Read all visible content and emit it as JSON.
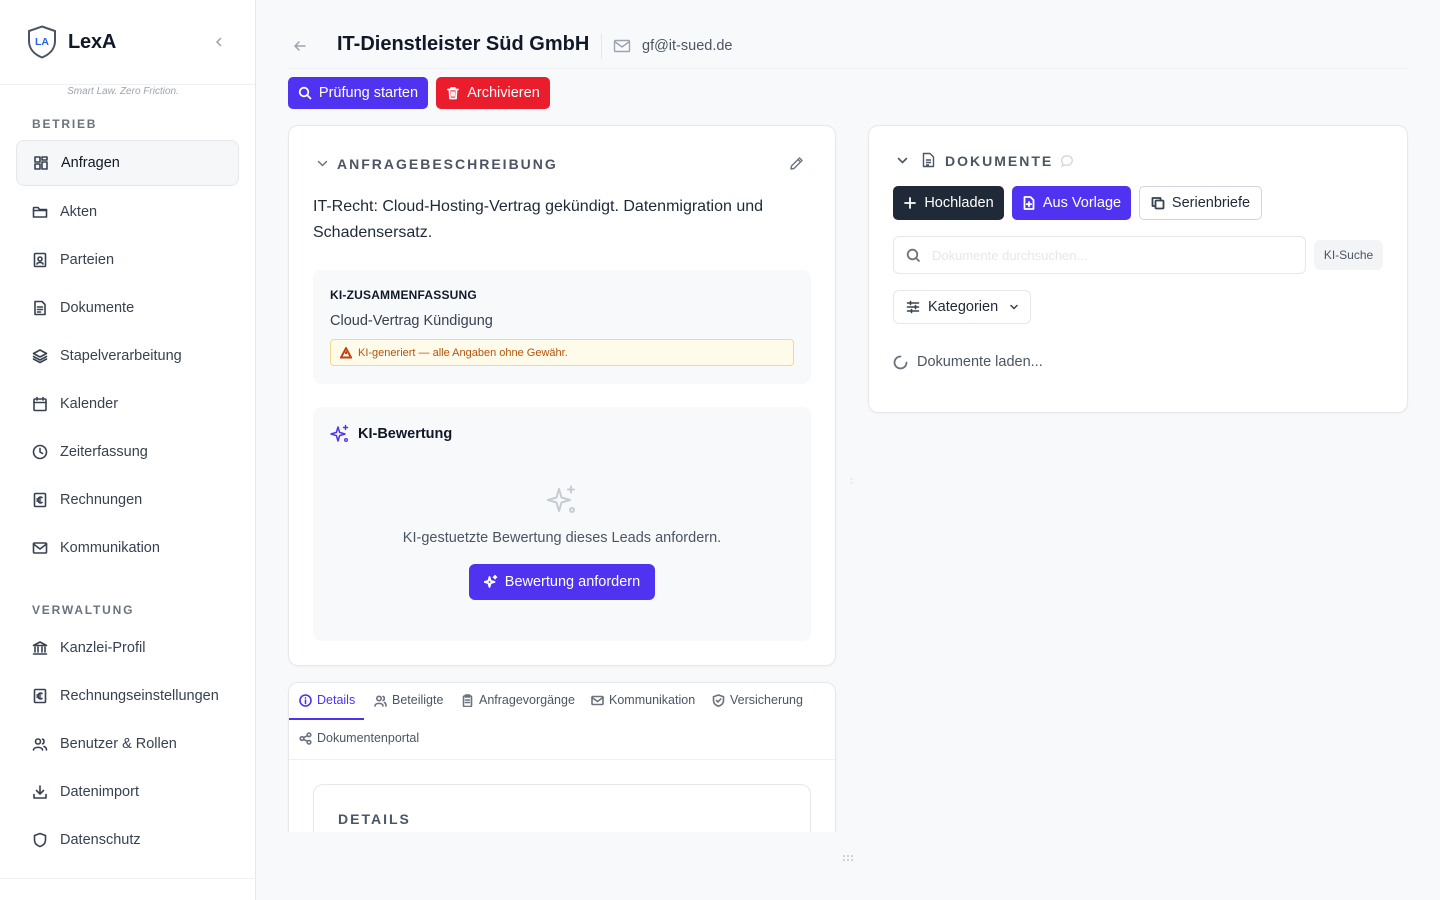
{
  "app": {
    "name": "LexA",
    "tagline": "Smart Law. Zero Friction.",
    "logo_text": "LA"
  },
  "colors": {
    "accent": "#4f33f0",
    "danger": "#ea1d2c",
    "dark": "#1f2937",
    "warning_bg": "#fffbeb"
  },
  "sidebar": {
    "sections": [
      {
        "label": "BETRIEB",
        "items": [
          {
            "label": "Anfragen",
            "icon": "grid-icon",
            "active": true
          },
          {
            "label": "Akten",
            "icon": "folder-icon"
          },
          {
            "label": "Parteien",
            "icon": "contact-icon"
          },
          {
            "label": "Dokumente",
            "icon": "file-icon"
          },
          {
            "label": "Stapelverarbeitung",
            "icon": "layers-icon"
          },
          {
            "label": "Kalender",
            "icon": "calendar-icon"
          },
          {
            "label": "Zeiterfassung",
            "icon": "clock-icon"
          },
          {
            "label": "Rechnungen",
            "icon": "euro-receipt-icon"
          },
          {
            "label": "Kommunikation",
            "icon": "mail-icon"
          }
        ]
      },
      {
        "label": "VERWALTUNG",
        "items": [
          {
            "label": "Kanzlei-Profil",
            "icon": "bank-icon"
          },
          {
            "label": "Rechnungseinstellungen",
            "icon": "euro-receipt-icon"
          },
          {
            "label": "Benutzer & Rollen",
            "icon": "users-icon"
          },
          {
            "label": "Datenimport",
            "icon": "download-icon"
          },
          {
            "label": "Datenschutz",
            "icon": "shield-icon"
          }
        ]
      }
    ]
  },
  "header": {
    "title": "IT-Dienstleister Süd GmbH",
    "email": "gf@it-sued.de",
    "actions": {
      "start_review": "Prüfung starten",
      "archive": "Archivieren"
    }
  },
  "inquiry": {
    "section_title": "ANFRAGEBESCHREIBUNG",
    "description": "IT-Recht: Cloud-Hosting-Vertrag gekündigt. Datenmigration und Schadensersatz.",
    "ai_summary": {
      "label": "KI-ZUSAMMENFASSUNG",
      "text": "Cloud-Vertrag Kündigung",
      "warning": "KI-generiert — alle Angaben ohne Gewähr."
    },
    "ai_rating": {
      "title": "KI-Bewertung",
      "empty_text": "KI-gestuetzte Bewertung dieses Leads anfordern.",
      "button": "Bewertung anfordern"
    }
  },
  "tabs": {
    "items": [
      {
        "label": "Details",
        "icon": "info-icon",
        "active": true
      },
      {
        "label": "Beteiligte",
        "icon": "users-icon"
      },
      {
        "label": "Anfragevorgänge",
        "icon": "clipboard-icon"
      },
      {
        "label": "Kommunikation",
        "icon": "mail-icon"
      },
      {
        "label": "Versicherung",
        "icon": "shield-check-icon"
      },
      {
        "label": "Dokumentenportal",
        "icon": "share-icon"
      }
    ],
    "details_title": "DETAILS"
  },
  "documents": {
    "section_title": "DOKUMENTE",
    "upload": "Hochladen",
    "from_template": "Aus Vorlage",
    "serial_letters": "Serienbriefe",
    "search_placeholder": "Dokumente durchsuchen...",
    "ai_search": "KI-Suche",
    "categories": "Kategorien",
    "loading": "Dokumente laden..."
  }
}
